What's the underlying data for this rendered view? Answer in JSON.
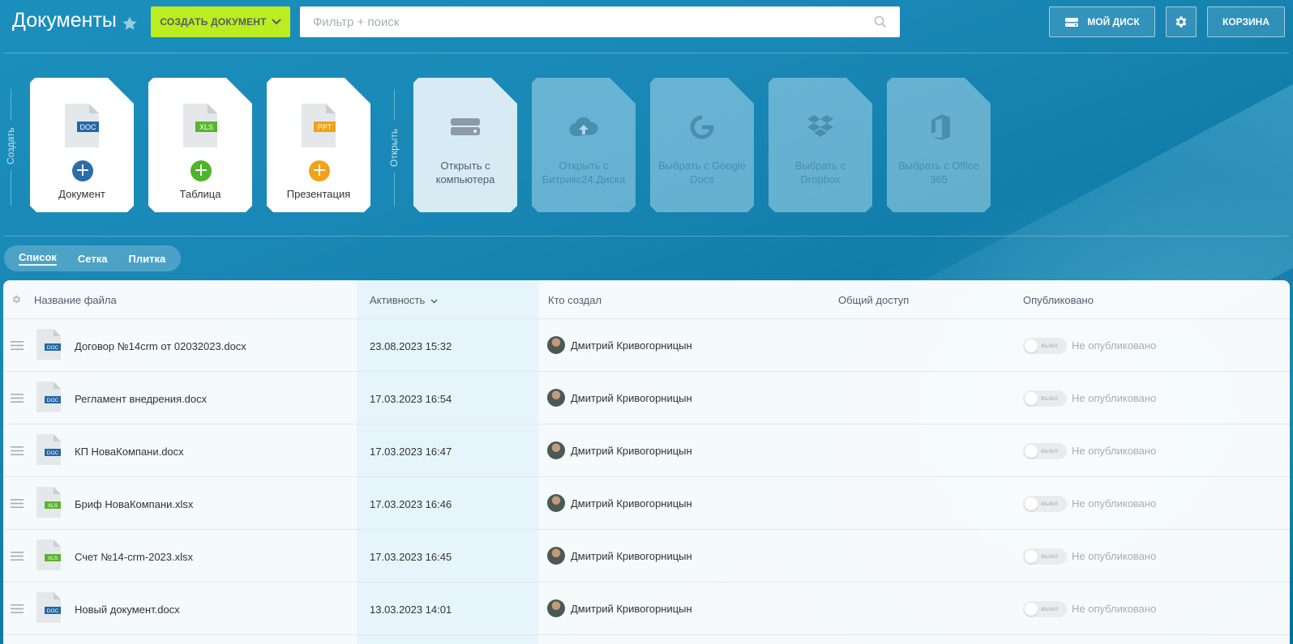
{
  "header": {
    "title": "Документы",
    "create_button": "СОЗДАТЬ ДОКУМЕНТ",
    "search_placeholder": "Фильтр + поиск",
    "my_disk": "МОЙ ДИСК",
    "trash": "КОРЗИНА"
  },
  "create": {
    "section_label": "Создать",
    "tiles": [
      {
        "label": "Документ",
        "badge": "DOC",
        "color": "#2467a7",
        "plus_color": "#2b6cab"
      },
      {
        "label": "Таблица",
        "badge": "XLS",
        "color": "#5ab42c",
        "plus_color": "#50b42b"
      },
      {
        "label": "Презентация",
        "badge": "PPT",
        "color": "#f0a316",
        "plus_color": "#f0a316"
      }
    ]
  },
  "open": {
    "section_label": "Открыть",
    "tiles": [
      {
        "label": "Открыть с компьютера",
        "icon": "hard-drive-icon"
      },
      {
        "label": "Открыть с Битрикс24.Диска",
        "icon": "cloud-upload-icon"
      },
      {
        "label": "Выбрать с Google Docs",
        "icon": "google-icon"
      },
      {
        "label": "Выбрать с Dropbox",
        "icon": "dropbox-icon"
      },
      {
        "label": "Выбрать с Office 365",
        "icon": "office365-icon"
      }
    ]
  },
  "views": [
    "Список",
    "Сетка",
    "Плитка"
  ],
  "grid": {
    "columns": [
      "Название файла",
      "Активность",
      "Кто создал",
      "Общий доступ",
      "Опубликовано"
    ],
    "rows": [
      {
        "name": "Договор №14crm от 02032023.docx",
        "type": "DOC",
        "date": "23.08.2023 15:32",
        "author": "Дмитрий Кривогорницын",
        "toggle": "выкл",
        "published": "Не опубликовано"
      },
      {
        "name": "Регламент внедрения.docx",
        "type": "DOC",
        "date": "17.03.2023 16:54",
        "author": "Дмитрий Кривогорницын",
        "toggle": "выкл",
        "published": "Не опубликовано"
      },
      {
        "name": "КП НоваКомпани.docx",
        "type": "DOC",
        "date": "17.03.2023 16:47",
        "author": "Дмитрий Кривогорницын",
        "toggle": "выкл",
        "published": "Не опубликовано"
      },
      {
        "name": "Бриф НоваКомпани.xlsx",
        "type": "XLS",
        "date": "17.03.2023 16:46",
        "author": "Дмитрий Кривогорницын",
        "toggle": "выкл",
        "published": "Не опубликовано"
      },
      {
        "name": "Счет №14-crm-2023.xlsx",
        "type": "XLS",
        "date": "17.03.2023 16:45",
        "author": "Дмитрий Кривогорницын",
        "toggle": "выкл",
        "published": "Не опубликовано"
      },
      {
        "name": "Новый документ.docx",
        "type": "DOC",
        "date": "13.03.2023 14:01",
        "author": "Дмитрий Кривогорницын",
        "toggle": "выкл",
        "published": "Не опубликовано"
      }
    ]
  },
  "colors": {
    "doc": "#2467a7",
    "xls": "#5ab42c",
    "ppt": "#f0a316",
    "accent_create": "#bbed21"
  }
}
